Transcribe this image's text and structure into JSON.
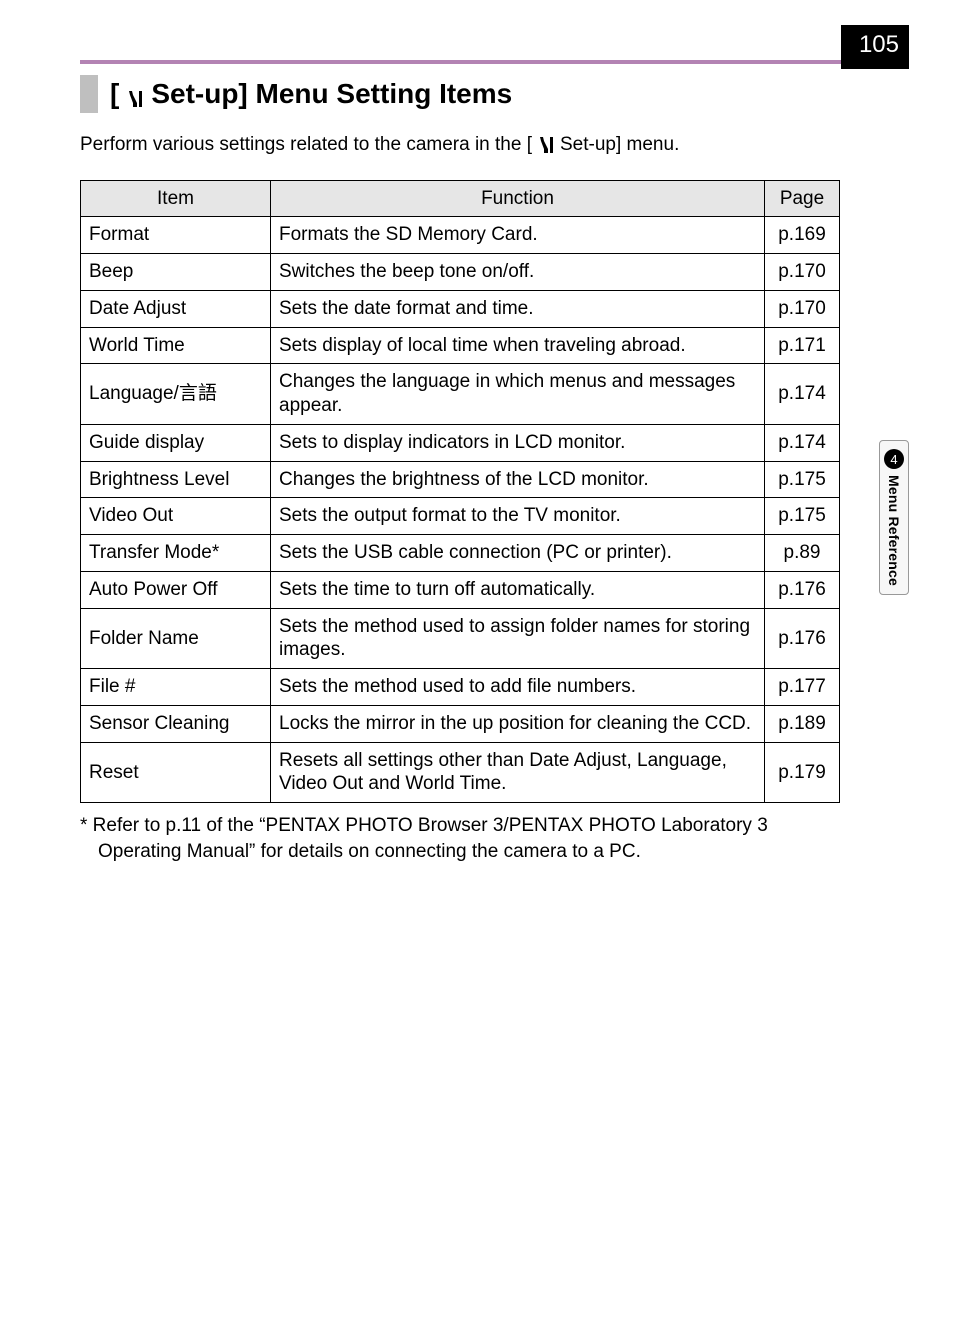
{
  "page_number": "105",
  "side_tab": {
    "chapter_num": "4",
    "label": "Menu Reference"
  },
  "heading": {
    "prefix": "[",
    "suffix": " Set-up] Menu Setting Items"
  },
  "intro": {
    "before": "Perform various settings related to the camera in the [",
    "after": " Set-up] menu."
  },
  "table": {
    "head": {
      "item": "Item",
      "function": "Function",
      "page": "Page"
    },
    "rows": [
      {
        "item": "Format",
        "func": "Formats the SD Memory Card.",
        "page": "p.169"
      },
      {
        "item": "Beep",
        "func": "Switches the beep tone on/off.",
        "page": "p.170"
      },
      {
        "item": "Date Adjust",
        "func": "Sets the date format and time.",
        "page": "p.170"
      },
      {
        "item": "World Time",
        "func": "Sets display of local time when traveling abroad.",
        "page": "p.171"
      },
      {
        "item": "Language/言語",
        "func": "Changes the language in which menus and messages appear.",
        "page": "p.174"
      },
      {
        "item": "Guide display",
        "func": "Sets to display indicators in LCD monitor.",
        "page": "p.174"
      },
      {
        "item": "Brightness Level",
        "func": "Changes the brightness of the LCD monitor.",
        "page": "p.175"
      },
      {
        "item": "Video Out",
        "func": "Sets the output format to the TV monitor.",
        "page": "p.175"
      },
      {
        "item": "Transfer Mode*",
        "func": "Sets the USB cable connection (PC or printer).",
        "page": "p.89"
      },
      {
        "item": "Auto Power Off",
        "func": "Sets the time to turn off automatically.",
        "page": "p.176"
      },
      {
        "item": "Folder Name",
        "func": "Sets the method used to assign folder names for storing images.",
        "page": "p.176"
      },
      {
        "item": "File #",
        "func": "Sets the method used to add file numbers.",
        "page": "p.177"
      },
      {
        "item": "Sensor Cleaning",
        "func": "Locks the mirror in the up position for cleaning the CCD.",
        "page": "p.189"
      },
      {
        "item": "Reset",
        "func": "Resets all settings other than Date Adjust, Language, Video Out and World Time.",
        "page": "p.179"
      }
    ]
  },
  "footnote": "*  Refer to p.11 of the “PENTAX PHOTO Browser 3/PENTAX PHOTO Laboratory 3 Operating Manual” for details on connecting the camera to a PC."
}
